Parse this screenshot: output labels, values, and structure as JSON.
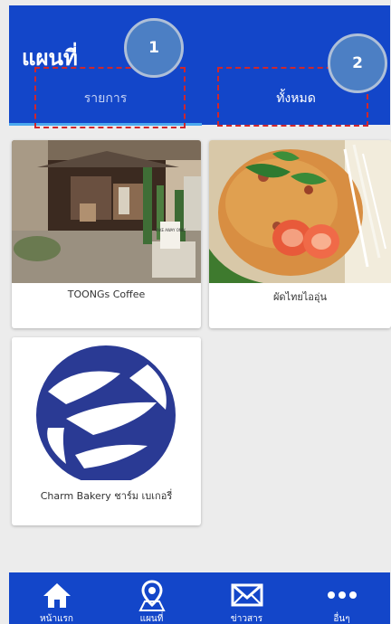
{
  "header": {
    "title": "แผนที่",
    "tabs": [
      {
        "label": "รายการ",
        "active": true
      },
      {
        "label": "ทั้งหมด",
        "active": false
      }
    ],
    "markers": [
      "1",
      "2"
    ]
  },
  "cards": [
    {
      "name": "TOONGs Coffee",
      "image": "cafe-storefront-photo",
      "sign_text": "TAKE AWAY ONLY"
    },
    {
      "name": "ผัดไทยไออุ่น",
      "image": "pad-thai-shrimp-photo"
    },
    {
      "name": "Charm Bakery ชาร์ม เบเกอรี่",
      "image": "charm-bakery-logo"
    }
  ],
  "bottom_nav": [
    {
      "label": "หน้าแรก",
      "icon": "home-icon"
    },
    {
      "label": "แผนที่",
      "icon": "map-pin-icon",
      "active": true
    },
    {
      "label": "ข่าวสาร",
      "icon": "mail-icon"
    },
    {
      "label": "อื่นๆ",
      "icon": "more-dots-icon"
    }
  ],
  "colors": {
    "primary": "#1346c9",
    "tab_indicator": "#4aa8f0",
    "annotation_box": "#d0262c",
    "annotation_marker": "#4c7fc4",
    "background": "#ececec"
  }
}
